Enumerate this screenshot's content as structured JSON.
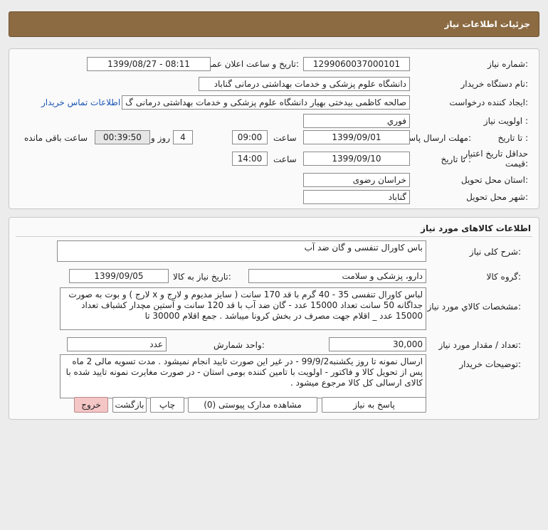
{
  "header": {
    "title": "جزئیات اطلاعات نیاز"
  },
  "general": {
    "need_number_label": "شماره نیاز:",
    "need_number": "1299060037000101",
    "announce_label": "تاریخ و ساعت اعلان عمومی:",
    "announce_value": "1399/08/27 - 08:11",
    "buyer_label": "نام دستگاه خریدار:",
    "buyer_value": "دانشگاه علوم پزشکی و خدمات بهداشتی درمانی گناباد",
    "requester_label": "ایجاد کننده درخواست:",
    "requester_value": "صالحه کاظمی بیدختی بهیار دانشگاه علوم پزشکی و خدمات بهداشتی درمانی گ",
    "contact_link": "اطلاعات تماس خریدار",
    "priority_label": "اولویت نیاز :",
    "priority_value": "فوري",
    "deadline_label": "مهلت ارسال پاسخ:",
    "to_date_label": "تا تاریخ :",
    "deadline_date": "1399/09/01",
    "time_label": "ساعت",
    "deadline_time": "09:00",
    "days_value": "4",
    "days_label": "روز و",
    "remaining_time": "00:39:50",
    "remaining_label": "ساعت باقی مانده",
    "validity_label_1": "حداقل تاریخ اعتبار",
    "validity_label_2": "قیمت:",
    "validity_to_label": "تا تاریخ :",
    "validity_date": "1399/09/10",
    "validity_time_label": "ساعت",
    "validity_time": "14:00",
    "province_label": "استان محل تحویل:",
    "province_value": "خراسان رضوی",
    "city_label": "شهر محل تحویل:",
    "city_value": "گناباد"
  },
  "goods": {
    "section_title": "اطلاعات کالاهای مورد نیاز",
    "summary_label": "شرح کلی نیاز:",
    "summary_value": "باس کاورال تنفسی و گان ضد آب",
    "group_label": "گروه کالا:",
    "group_value": "دارو، پزشکی و سلامت",
    "need_date_label": "تاریخ نیاز به کالا:",
    "need_date_value": "1399/09/05",
    "spec_label": "مشخصات کالاي مورد نياز:",
    "spec_value": "لباس کاورال تنفسی 35 - 40 گرم با قد 170 سانت ( سایز مدیوم و لارج و x لارج ) و بوت به صورت جداگانه 50 سانت تعداد 15000 عدد - گان ضد آب با قد 120 سانت و آستین مچدار کشباف تعداد 15000 عدد _ اقلام جهت مصرف در بخش کرونا میباشد . جمع اقلام 30000 تا",
    "qty_label": "تعداد / مقدار مورد نیاز:",
    "qty_value": "30,000",
    "unit_label": "واحد شمارش:",
    "unit_value": "عدد",
    "desc_label": "توضیحات خریدار:",
    "desc_value": "ارسال نمونه تا روز یکشنبه99/9/2 - در غیر این صورت تایید انجام نمیشود . مدت تسویه مالی 2 ماه پس از تحویل کالا و فاکتور - اولویت با تامین کننده بومی استان - در صورت مغایرت نمونه تایید شده با کالای ارسالی کل کالا مرجوع میشود ."
  },
  "actions": {
    "reply": "پاسخ به نیاز",
    "attachments": "مشاهده مدارک پیوستی (0)",
    "print": "چاپ",
    "back": "بازگشت",
    "exit": "خروج"
  }
}
